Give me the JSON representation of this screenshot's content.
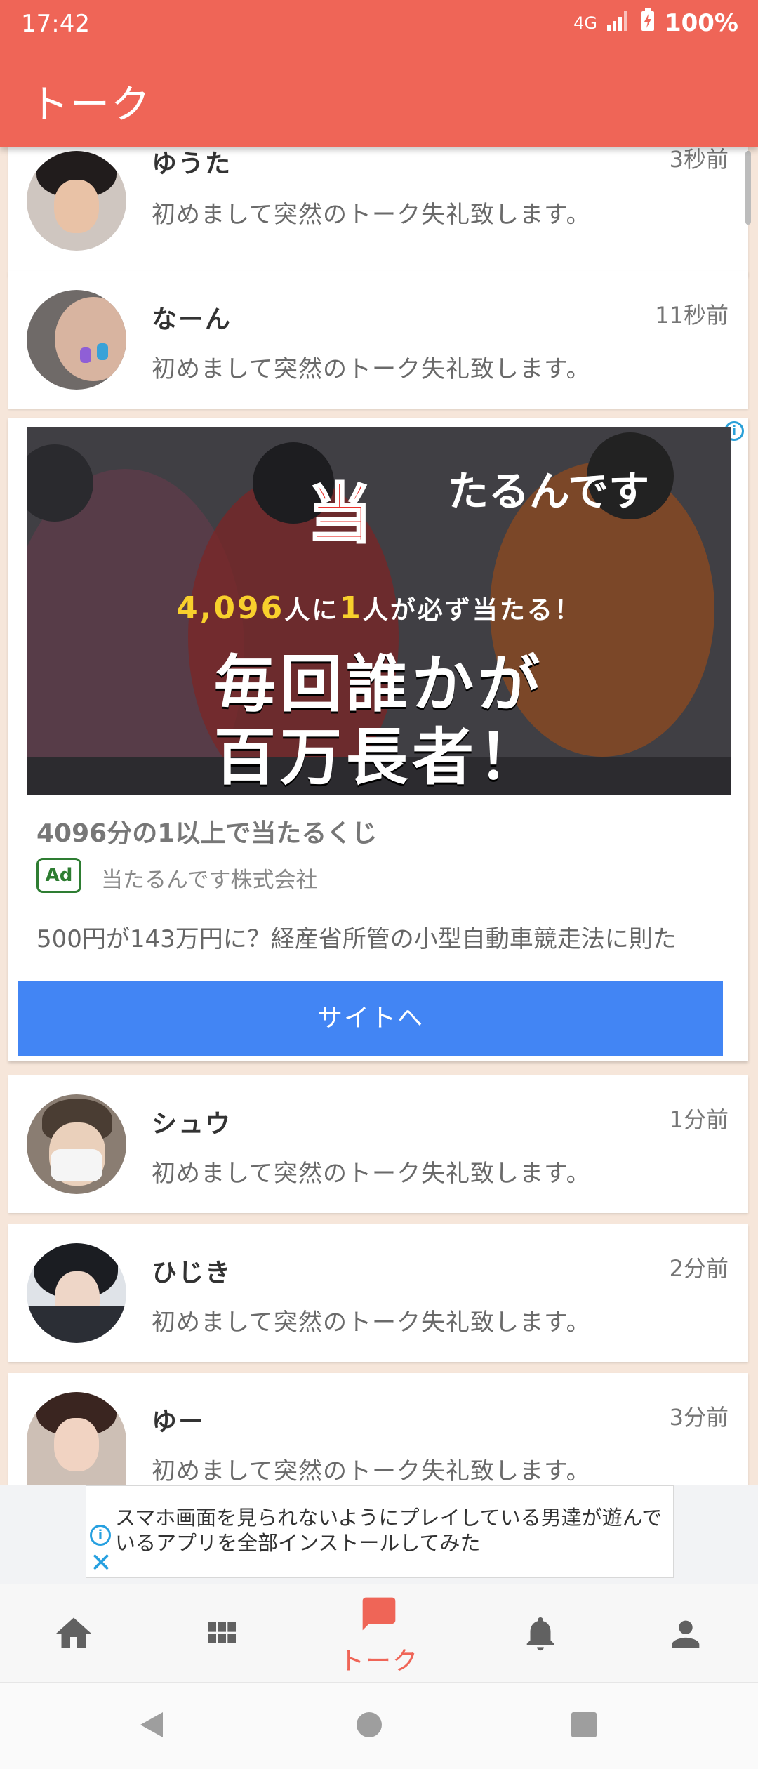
{
  "status_bar": {
    "time": "17:42",
    "network": "4G",
    "battery": "100%"
  },
  "app_bar": {
    "title": "トーク"
  },
  "talks_top": [
    {
      "name": "ゆうた",
      "time_ago": "3秒前",
      "message": "初めまして突然のトーク失礼致します。"
    },
    {
      "name": "なーん",
      "time_ago": "11秒前",
      "message": "初めまして突然のトーク失礼致します。"
    }
  ],
  "ad": {
    "image_logo": "当",
    "image_logo_sub": "たるんです",
    "image_sub_number": "4,096",
    "image_sub_mid": "人に",
    "image_sub_one": "1",
    "image_sub_tail": "人が必ず当たる！",
    "image_headline_1": "毎回誰かが",
    "image_headline_2": "百万長者！",
    "title": "4096分の1以上で当たるくじ",
    "badge": "Ad",
    "company": "当たるんです株式会社",
    "description": "500円が143万円に？経産省所管の小型自動車競走法に則た",
    "cta": "サイトへ"
  },
  "talks_bottom": [
    {
      "name": "シュウ",
      "time_ago": "1分前",
      "message": "初めまして突然のトーク失礼致します。"
    },
    {
      "name": "ひじき",
      "time_ago": "2分前",
      "message": "初めまして突然のトーク失礼致します。"
    },
    {
      "name": "ゆー",
      "time_ago": "3分前",
      "message": "初めまして突然のトーク失礼致します。"
    }
  ],
  "banner": {
    "text": "スマホ画面を見られないようにプレイしている男達が遊んでいるアプリを全部インストールしてみた"
  },
  "bottom_nav": {
    "items": [
      {
        "icon": "home-icon"
      },
      {
        "icon": "grid-icon"
      },
      {
        "icon": "chat-icon",
        "label": "トーク",
        "active": true
      },
      {
        "icon": "bell-icon"
      },
      {
        "icon": "person-icon"
      }
    ]
  },
  "colors": {
    "accent": "#ef6557",
    "background": "#f6e6da",
    "cta": "#4285f4",
    "ad_badge": "#2e7d32"
  }
}
